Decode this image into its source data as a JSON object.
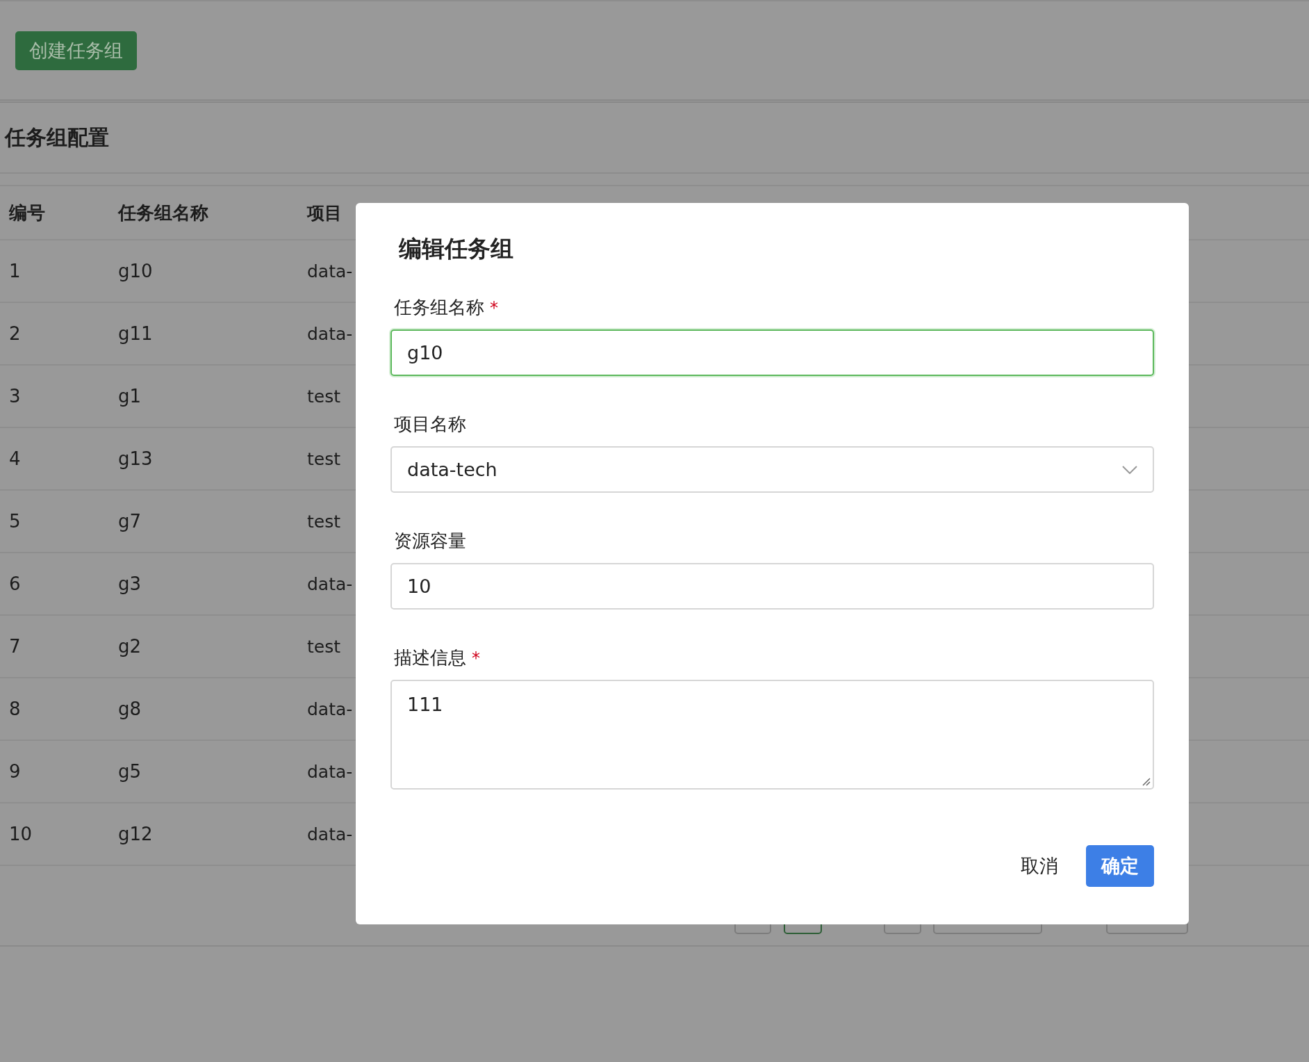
{
  "create_button": "创建任务组",
  "section_title": "任务组配置",
  "table": {
    "columns": [
      "编号",
      "任务组名称",
      "项目"
    ],
    "rows": [
      [
        "1",
        "g10",
        "data-"
      ],
      [
        "2",
        "g11",
        "data-"
      ],
      [
        "3",
        "g1",
        "test"
      ],
      [
        "4",
        "g13",
        "test"
      ],
      [
        "5",
        "g7",
        "test"
      ],
      [
        "6",
        "g3",
        "data-"
      ],
      [
        "7",
        "g2",
        "test"
      ],
      [
        "8",
        "g8",
        "data-"
      ],
      [
        "9",
        "g5",
        "data-"
      ],
      [
        "10",
        "g12",
        "data-"
      ]
    ]
  },
  "pagination": [
    {
      "selected": false
    },
    {
      "selected": true
    },
    {
      "selected": false
    },
    {
      "selected": false
    },
    {
      "selected": false
    }
  ],
  "dialog": {
    "title": "编辑任务组",
    "fields": [
      {
        "kind": "input",
        "label": "任务组名称",
        "required": true,
        "focused": true,
        "value": "g10"
      },
      {
        "kind": "select",
        "label": "项目名称",
        "required": false,
        "focused": false,
        "value": "data-tech"
      },
      {
        "kind": "input",
        "label": "资源容量",
        "required": false,
        "focused": false,
        "value": "10"
      },
      {
        "kind": "textarea",
        "label": "描述信息",
        "required": true,
        "focused": false,
        "value": "111"
      }
    ],
    "required_mark": "*",
    "cancel": "取消",
    "ok": "确定"
  }
}
